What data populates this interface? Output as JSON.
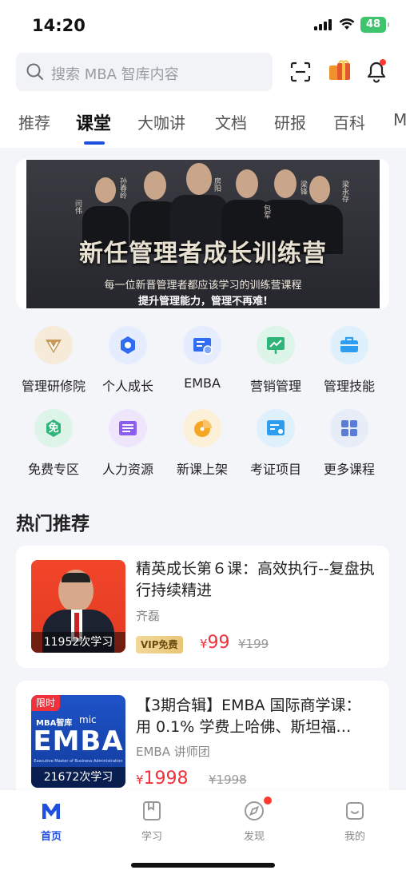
{
  "status": {
    "time": "14:20",
    "battery": "48"
  },
  "search": {
    "placeholder": "搜索 MBA 智库内容"
  },
  "tabs": [
    {
      "label": "推荐"
    },
    {
      "label": "课堂"
    },
    {
      "label": "大咖讲"
    },
    {
      "label": "文档"
    },
    {
      "label": "研报"
    },
    {
      "label": "百科"
    },
    {
      "label": "M"
    }
  ],
  "active_tab": "课堂",
  "banner": {
    "title": "新任管理者成长训练营",
    "subtitle1": "每一位新晋管理者都应该学习的训练营课程",
    "subtitle2": "提升管理能力，管理不再难!",
    "names": [
      "闫伟",
      "孙春岭",
      "房阳",
      "包军",
      "梁锋",
      "梁永存"
    ]
  },
  "categories": [
    {
      "label": "管理研修院",
      "icon": "v-diamond-icon",
      "color": "#c79a5a"
    },
    {
      "label": "个人成长",
      "icon": "hexagon-icon",
      "color": "#2f6ef2"
    },
    {
      "label": "EMBA",
      "icon": "certificate-icon",
      "color": "#2f6ef2"
    },
    {
      "label": "营销管理",
      "icon": "presentation-chart-icon",
      "color": "#2fb579"
    },
    {
      "label": "管理技能",
      "icon": "briefcase-icon",
      "color": "#2e9df0"
    },
    {
      "label": "免费专区",
      "icon": "free-badge-icon",
      "color": "#2fb579",
      "glyph": "免"
    },
    {
      "label": "人力资源",
      "icon": "list-card-icon",
      "color": "#8c5cf0"
    },
    {
      "label": "新课上架",
      "icon": "pie-chart-icon",
      "color": "#f5a623"
    },
    {
      "label": "考证项目",
      "icon": "id-card-icon",
      "color": "#2e9df0"
    },
    {
      "label": "更多课程",
      "icon": "grid-icon",
      "color": "#5a7bd6"
    }
  ],
  "hot": {
    "title": "热门推荐",
    "courses": [
      {
        "title": "精英成长第６课：高效执行--复盘执行持续精进",
        "author": "齐磊",
        "learners": "11952次学习",
        "vip": "VIP免费",
        "currency": "¥",
        "price": "99",
        "original_price": "¥199"
      },
      {
        "title": "【3期合辑】EMBA 国际商学课：用 0.1% 学费上哈佛、斯坦福…",
        "author": "EMBA 讲师团",
        "learners": "21672次学习",
        "tag": "限时",
        "thumb_brand": "MBA智库",
        "thumb_mic": "mic",
        "thumb_big": "EMBA",
        "thumb_small": "Executive Master of Business Administration",
        "currency": "¥",
        "price": "1998",
        "original_price": "¥1998"
      }
    ]
  },
  "nav": [
    {
      "label": "首页",
      "icon": "home-m-icon",
      "active": true
    },
    {
      "label": "学习",
      "icon": "bookmark-book-icon"
    },
    {
      "label": "发现",
      "icon": "compass-icon",
      "badge": true
    },
    {
      "label": "我的",
      "icon": "profile-face-icon"
    }
  ],
  "colors": {
    "accent": "#1e4fe0",
    "price": "#f0303a",
    "badge": "#ff3b30"
  }
}
